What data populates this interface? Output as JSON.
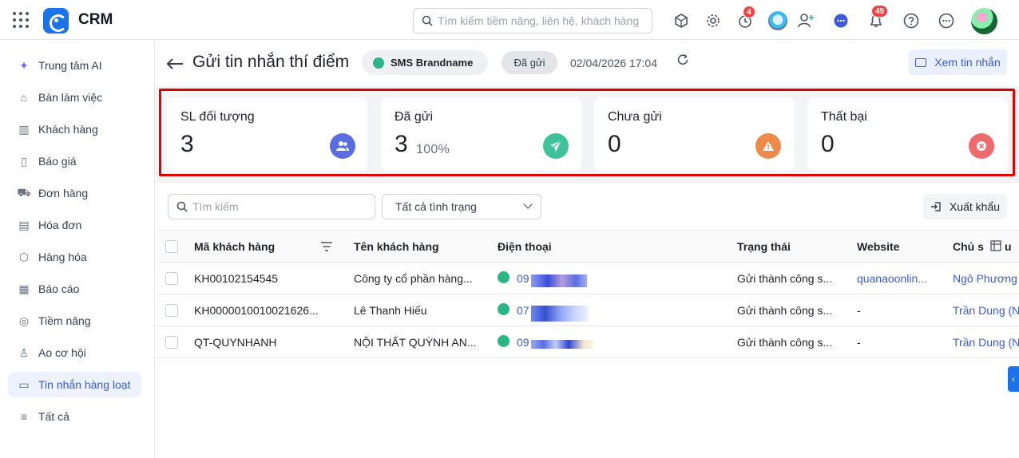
{
  "app": {
    "title": "CRM"
  },
  "topbar": {
    "search_placeholder": "Tìm kiếm tiềm năng, liên hệ, khách hàng",
    "timer_badge": "4",
    "notification_badge": "49"
  },
  "sidebar": {
    "items": [
      {
        "label": "Trung tâm AI",
        "icon": "sparkle-icon",
        "glyph": "✦"
      },
      {
        "label": "Bàn làm việc",
        "icon": "home-icon",
        "glyph": "⌂"
      },
      {
        "label": "Khách hàng",
        "icon": "building-icon",
        "glyph": "▥"
      },
      {
        "label": "Báo giá",
        "icon": "quote-doc-icon",
        "glyph": "▯"
      },
      {
        "label": "Đơn hàng",
        "icon": "cart-icon",
        "glyph": "⛟"
      },
      {
        "label": "Hóa đơn",
        "icon": "invoice-icon",
        "glyph": "▤"
      },
      {
        "label": "Hàng hóa",
        "icon": "box-icon",
        "glyph": "⬡"
      },
      {
        "label": "Báo cáo",
        "icon": "chart-icon",
        "glyph": "▦"
      },
      {
        "label": "Tiềm năng",
        "icon": "lead-icon",
        "glyph": "◎"
      },
      {
        "label": "Ao cơ hội",
        "icon": "opportunity-icon",
        "glyph": "♙"
      },
      {
        "label": "Tin nhắn hàng loạt",
        "icon": "message-icon",
        "glyph": "▭"
      },
      {
        "label": "Tất cả",
        "icon": "menu-icon",
        "glyph": "≡"
      }
    ]
  },
  "header": {
    "title": "Gửi tin nhắn thí điểm",
    "channel": "SMS Brandname",
    "status": "Đã gửi",
    "datetime": "02/04/2026 17:04",
    "view_button": "Xem tin nhắn"
  },
  "stats": [
    {
      "label": "SL đối tượng",
      "value": "3",
      "pct": "",
      "icon": "users-icon",
      "color": "#5b6ee1"
    },
    {
      "label": "Đã gửi",
      "value": "3",
      "pct": "100%",
      "icon": "send-icon",
      "color": "#3ec29b"
    },
    {
      "label": "Chưa gửi",
      "value": "0",
      "pct": "",
      "icon": "warning-icon",
      "color": "#f08a4b"
    },
    {
      "label": "Thất bại",
      "value": "0",
      "pct": "",
      "icon": "error-icon",
      "color": "#ef6b6b"
    }
  ],
  "filters": {
    "search_placeholder": "Tìm kiếm",
    "status_value": "Tất cả tình trạng",
    "export_label": "Xuất khẩu"
  },
  "table": {
    "columns": [
      "Mã khách hàng",
      "Tên khách hàng",
      "Điện thoại",
      "Trạng thái",
      "Website",
      "Chủ s"
    ],
    "column_suffix": "u",
    "rows": [
      {
        "code": "KH00102154545",
        "name": "Công ty cổ phần hàng...",
        "phone": "09",
        "status": "Gửi thành công s...",
        "website": "quanaoonlin...",
        "owner": "Ngô Phương T"
      },
      {
        "code": "KH0000010010021626...",
        "name": "Lê Thanh Hiếu",
        "phone": "07",
        "status": "Gửi thành công s...",
        "website": "-",
        "owner": "Trần Dung (N"
      },
      {
        "code": "QT-QUYNHANH",
        "name": "NỘI THẤT QUỲNH AN...",
        "phone": "09",
        "status": "Gửi thành công s...",
        "website": "-",
        "owner": "Trần Dung (N"
      }
    ]
  }
}
